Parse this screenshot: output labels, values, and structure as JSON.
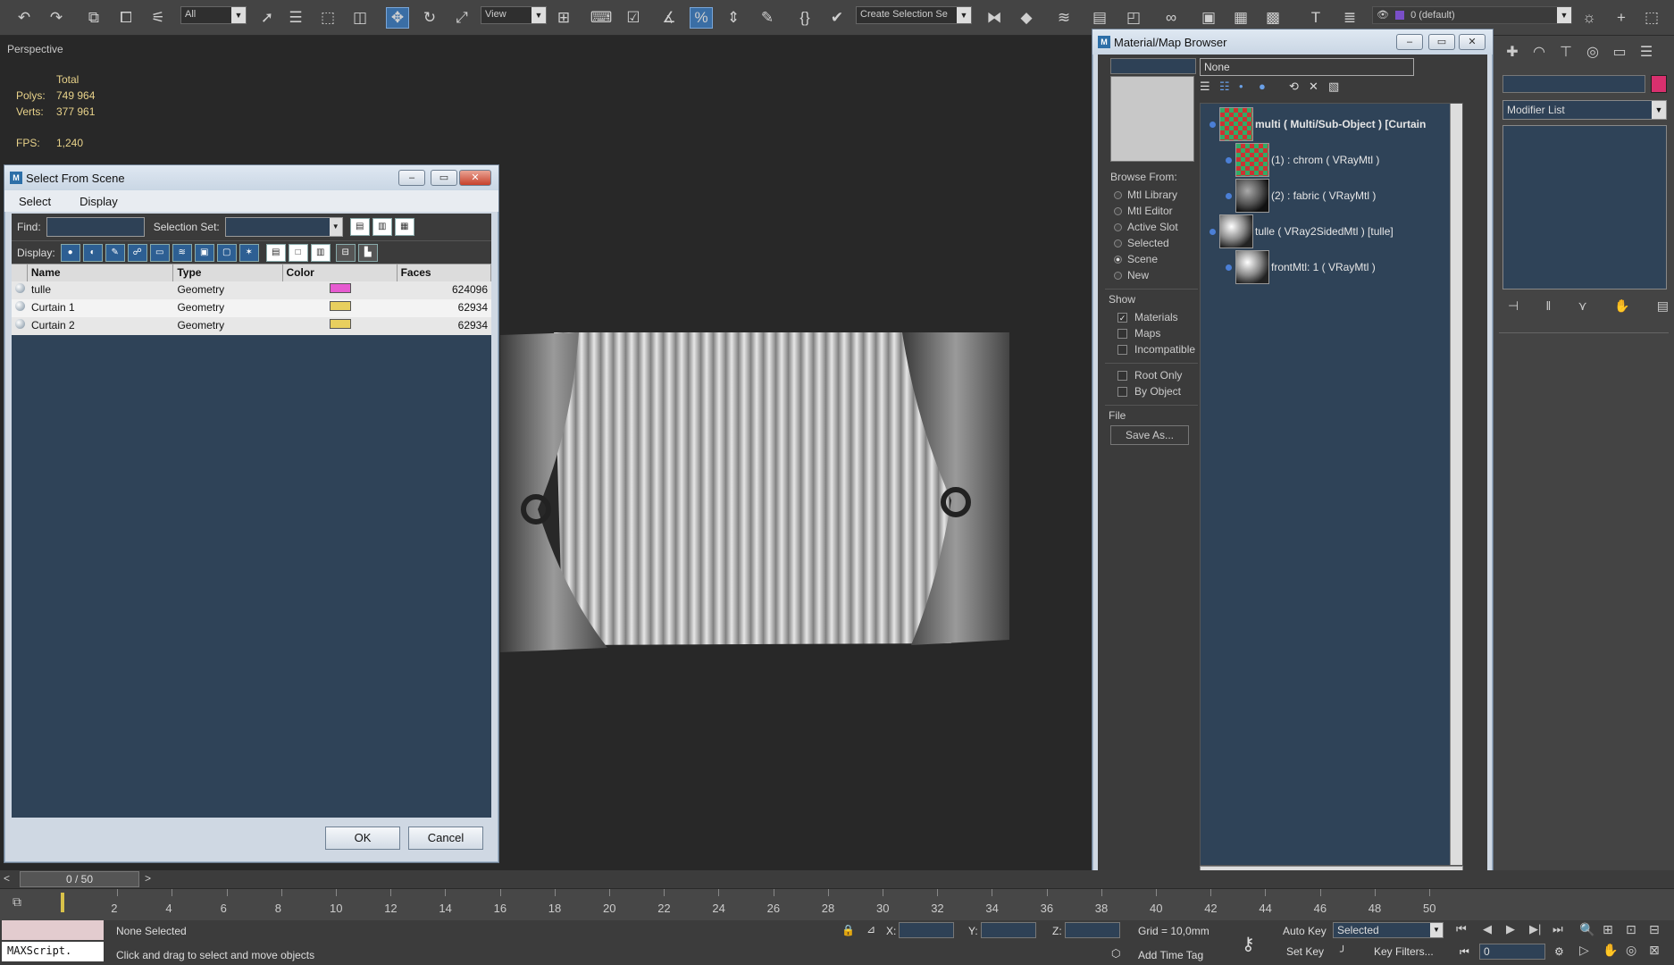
{
  "toolbar": {
    "filter_value": "All",
    "ref_coord_value": "View",
    "selection_set_placeholder": "Create Selection Se",
    "layer_value": "0 (default)"
  },
  "viewport": {
    "label": "Perspective",
    "stats": {
      "header": "Total",
      "polys_label": "Polys:",
      "polys_value": "749 964",
      "verts_label": "Verts:",
      "verts_value": "377 961",
      "fps_label": "FPS:",
      "fps_value": "1,240"
    }
  },
  "select_from_scene": {
    "title": "Select From Scene",
    "menu": [
      "Select",
      "Display"
    ],
    "find_label": "Find:",
    "selection_set_label": "Selection Set:",
    "display_label": "Display:",
    "columns": [
      "Name",
      "Type",
      "Color",
      "Faces"
    ],
    "rows": [
      {
        "name": "tulle",
        "type": "Geometry",
        "color": "#e65bd0",
        "faces": "624096"
      },
      {
        "name": "Curtain 1",
        "type": "Geometry",
        "color": "#e8cf5e",
        "faces": "62934"
      },
      {
        "name": "Curtain 2",
        "type": "Geometry",
        "color": "#e8cf5e",
        "faces": "62934"
      }
    ],
    "ok_label": "OK",
    "cancel_label": "Cancel"
  },
  "material_browser": {
    "title": "Material/Map Browser",
    "name_field": "None",
    "browse_from_label": "Browse From:",
    "browse_options": [
      "Mtl Library",
      "Mtl Editor",
      "Active Slot",
      "Selected",
      "Scene",
      "New"
    ],
    "browse_selected": "Scene",
    "show_label": "Show",
    "show_options": [
      {
        "label": "Materials",
        "checked": true
      },
      {
        "label": "Maps",
        "checked": false
      },
      {
        "label": "Incompatible",
        "checked": false
      }
    ],
    "extra_options": [
      {
        "label": "Root Only",
        "checked": false
      },
      {
        "label": "By Object",
        "checked": false
      }
    ],
    "file_label": "File",
    "save_as_label": "Save As...",
    "tree": [
      {
        "label": "multi  ( Multi/Sub-Object )  [Curtain",
        "bold": true
      },
      {
        "label": "(1) : chrom  ( VRayMtl )"
      },
      {
        "label": "(2) : fabric  ( VRayMtl )"
      },
      {
        "label": "tulle  ( VRay2SidedMtl )  [tulle]"
      },
      {
        "label": "frontMtl: 1  ( VRayMtl )"
      }
    ]
  },
  "command_panel": {
    "modifier_list": "Modifier List",
    "color_swatch": "#d8306e"
  },
  "timeline": {
    "frame_display": "0 / 50",
    "ticks": [
      "2",
      "4",
      "6",
      "8",
      "10",
      "12",
      "14",
      "16",
      "18",
      "20",
      "22",
      "24",
      "26",
      "28",
      "30",
      "32",
      "34",
      "36",
      "38",
      "40",
      "42",
      "44",
      "46",
      "48",
      "50"
    ]
  },
  "status": {
    "maxscript": "MAXScript.",
    "selection_status": "None Selected",
    "prompt": "Click and drag to select and move objects",
    "x_label": "X:",
    "y_label": "Y:",
    "z_label": "Z:",
    "grid": "Grid = 10,0mm",
    "add_time_tag": "Add Time Tag",
    "auto_key": "Auto Key",
    "set_key": "Set Key",
    "key_mode": "Selected",
    "key_filters": "Key Filters...",
    "frame_value": "0"
  }
}
